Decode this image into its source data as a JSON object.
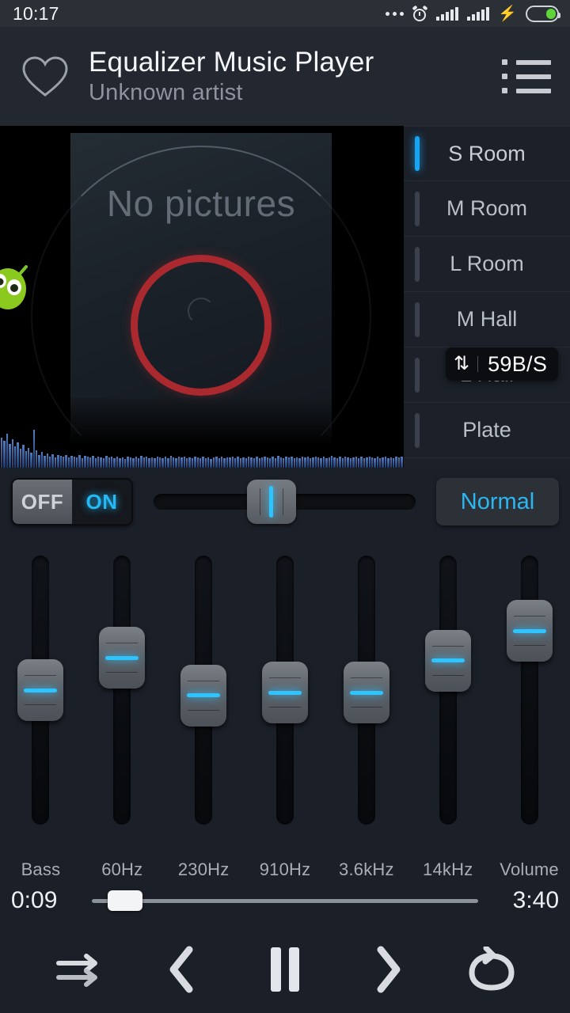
{
  "status_bar": {
    "time": "10:17",
    "icons": [
      "more-dots-icon",
      "alarm-icon",
      "signal-icon",
      "signal-icon",
      "charging-bolt-icon",
      "battery-icon"
    ]
  },
  "header": {
    "favorite_icon": "heart-icon",
    "title": "Equalizer Music Player",
    "artist": "Unknown artist",
    "playlist_icon": "playlist-icon"
  },
  "album_art": {
    "placeholder_text": "No pictures",
    "mascot_icon": "android-mascot-icon",
    "visualizer": "waveform-visualizer"
  },
  "reverb_presets": {
    "selected": "S Room",
    "items": [
      {
        "label": "S Room",
        "active": true
      },
      {
        "label": "M Room",
        "active": false
      },
      {
        "label": "L Room",
        "active": false
      },
      {
        "label": "M Hall",
        "active": false
      },
      {
        "label": "L Hall",
        "active": false
      },
      {
        "label": "Plate",
        "active": false
      }
    ]
  },
  "network_overlay": {
    "icon": "data-transfer-icon",
    "speed": "59B/S"
  },
  "controls": {
    "toggle_off_label": "OFF",
    "toggle_on_label": "ON",
    "toggle_state": "ON",
    "level_slider_percent": 45,
    "preset_button_label": "Normal"
  },
  "equalizer": {
    "bands": [
      {
        "label": "Bass",
        "position_percent": 50
      },
      {
        "label": "60Hz",
        "position_percent": 62
      },
      {
        "label": "230Hz",
        "position_percent": 48
      },
      {
        "label": "910Hz",
        "position_percent": 49
      },
      {
        "label": "3.6kHz",
        "position_percent": 49
      },
      {
        "label": "14kHz",
        "position_percent": 61
      },
      {
        "label": "Volume",
        "position_percent": 72
      }
    ]
  },
  "progress": {
    "elapsed": "0:09",
    "duration": "3:40",
    "percent": 4
  },
  "playback": {
    "buttons": [
      {
        "name": "shuffle-button",
        "icon": "shuffle-icon"
      },
      {
        "name": "previous-button",
        "icon": "previous-icon"
      },
      {
        "name": "play-pause-button",
        "icon": "pause-icon"
      },
      {
        "name": "next-button",
        "icon": "next-icon"
      },
      {
        "name": "repeat-button",
        "icon": "repeat-icon"
      }
    ]
  },
  "colors": {
    "accent_cyan": "#2cb6f2",
    "selected_bar": "#1aa3f0",
    "battery_green": "#5fd33a",
    "vinyl_red": "#b12a2f"
  }
}
